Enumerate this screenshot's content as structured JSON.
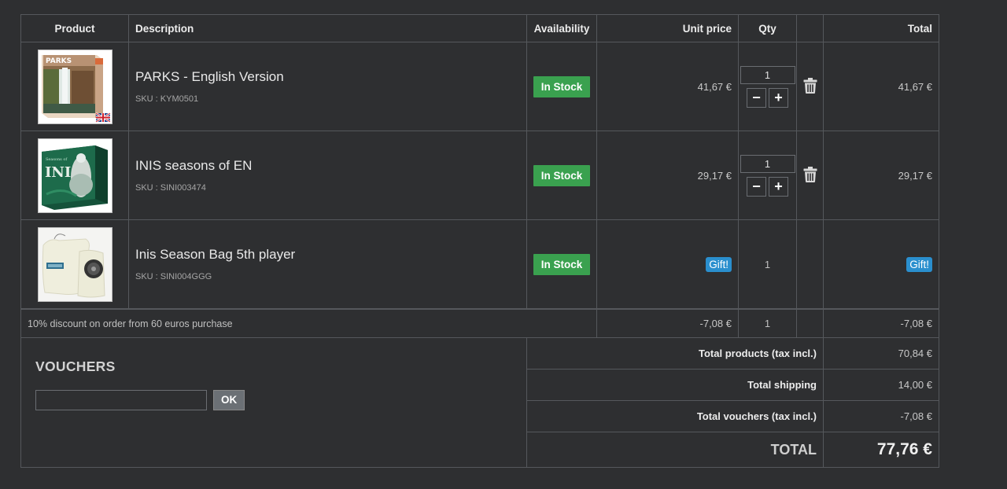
{
  "headers": {
    "product": "Product",
    "description": "Description",
    "availability": "Availability",
    "unit_price": "Unit price",
    "qty": "Qty",
    "total": "Total"
  },
  "items": [
    {
      "name": "PARKS - English Version",
      "sku": "SKU : KYM0501",
      "availability": "In Stock",
      "unit_price": "41,67 €",
      "qty": "1",
      "total": "41,67 €",
      "image_icon": "parks-box-image"
    },
    {
      "name": "INIS seasons of EN",
      "sku": "SKU : SINI003474",
      "availability": "In Stock",
      "unit_price": "29,17 €",
      "qty": "1",
      "total": "29,17 €",
      "image_icon": "inis-box-image"
    },
    {
      "name": "Inis Season Bag 5th player",
      "sku": "SKU : SINI004GGG",
      "availability": "In Stock",
      "unit_price": "Gift!",
      "qty": "1",
      "total": "Gift!",
      "image_icon": "bag-image"
    }
  ],
  "qty_controls": {
    "minus": "−",
    "plus": "+"
  },
  "discount": {
    "label": "10% discount on order from 60 euros purchase",
    "unit_price": "-7,08 €",
    "qty": "1",
    "total": "-7,08 €"
  },
  "vouchers": {
    "title": "VOUCHERS",
    "input_value": "",
    "ok_label": "OK"
  },
  "summary": {
    "products_label": "Total products (tax incl.)",
    "products_value": "70,84 €",
    "shipping_label": "Total shipping",
    "shipping_value": "14,00 €",
    "vouchers_label": "Total vouchers (tax incl.)",
    "vouchers_value": "-7,08 €",
    "total_label": "TOTAL",
    "total_value": "77,76 €"
  },
  "colors": {
    "background": "#2e2f31",
    "in_stock": "#3aa14f",
    "gift": "#2a8fce",
    "border": "#55585c"
  }
}
